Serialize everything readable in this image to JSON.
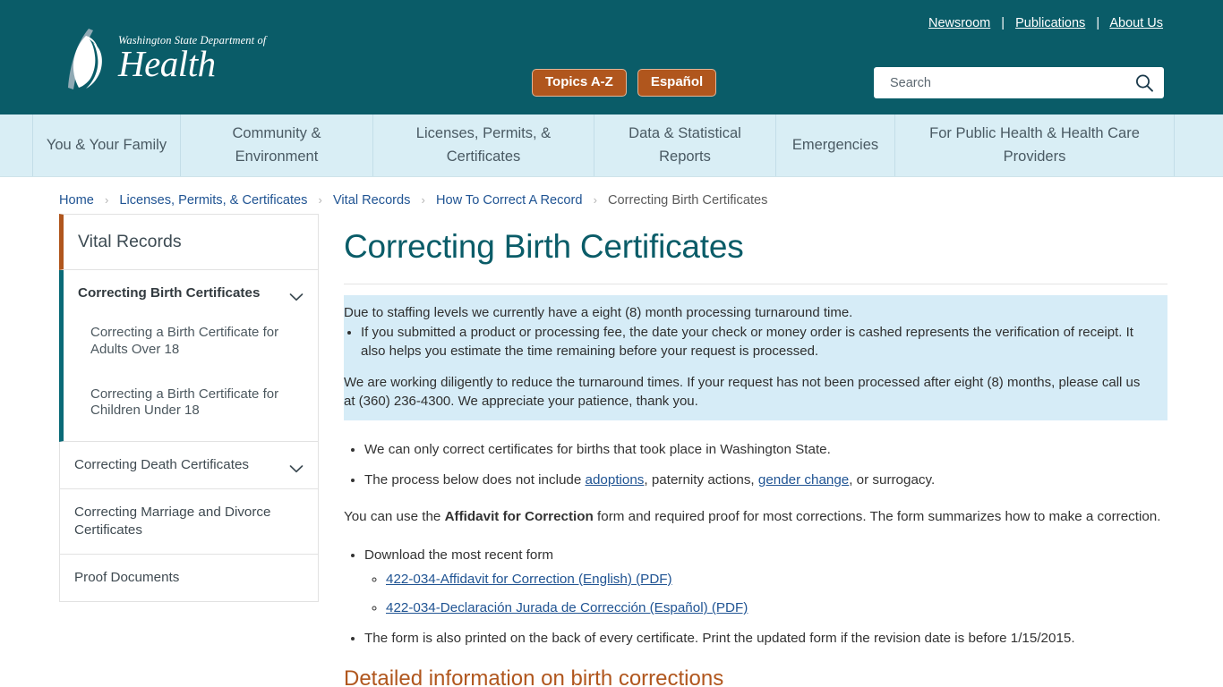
{
  "header": {
    "logo": {
      "icon": "doh-flame-logo",
      "line1": "Washington State Department of",
      "line2": "Health"
    },
    "util_links": [
      {
        "label": "Newsroom"
      },
      {
        "label": "Publications"
      },
      {
        "label": "About Us"
      }
    ],
    "util_separator": "|",
    "buttons": [
      {
        "label": "Topics A-Z"
      },
      {
        "label": "Español"
      }
    ],
    "search": {
      "placeholder": "Search",
      "value": "",
      "icon": "search-icon"
    },
    "colors": {
      "header_bg": "#0a5c68",
      "pill_bg": "#b0561d",
      "nav_bg": "#d9eef5",
      "accent_orange": "#b0561d",
      "accent_teal": "#0a6a77",
      "link_blue": "#205493",
      "alert_bg": "#d6ecf7"
    }
  },
  "nav": {
    "items": [
      {
        "label": "You & Your Family"
      },
      {
        "label": "Community & Environment"
      },
      {
        "label": "Licenses, Permits, & Certificates"
      },
      {
        "label": "Data & Statistical Reports"
      },
      {
        "label": "Emergencies"
      },
      {
        "label": "For Public Health & Health Care Providers"
      }
    ]
  },
  "breadcrumb": {
    "separator": "›",
    "items": [
      {
        "label": "Home",
        "current": false
      },
      {
        "label": "Licenses, Permits, & Certificates",
        "current": false
      },
      {
        "label": "Vital Records",
        "current": false
      },
      {
        "label": "How To Correct A Record",
        "current": false
      },
      {
        "label": "Correcting Birth Certificates",
        "current": true
      }
    ]
  },
  "sidebar": {
    "heading": "Vital Records",
    "active_group": {
      "title": "Correcting Birth Certificates",
      "chevron": "chevron-down-icon",
      "children": [
        {
          "label": "Correcting a Birth Certificate for Adults Over 18"
        },
        {
          "label": "Correcting a Birth Certificate for Children Under 18"
        }
      ]
    },
    "items": [
      {
        "label": "Correcting Death Certificates",
        "chevron": "chevron-down-icon",
        "expandable": true
      },
      {
        "label": "Correcting Marriage and Divorce Certificates",
        "expandable": false
      },
      {
        "label": "Proof Documents",
        "expandable": false
      }
    ]
  },
  "main": {
    "title": "Correcting Birth Certificates",
    "alert": {
      "intro": "Due to staffing levels we currently have a eight (8) month processing turnaround time.",
      "bullets": [
        "If you submitted a product or processing fee, the date your check or money order is cashed represents the verification of receipt. It also helps you estimate the time remaining before your request is processed."
      ],
      "closing": "We are working diligently to reduce the turnaround times. If your request has not been processed after eight (8) months, please call us at (360) 236-4300. We appreciate your patience, thank you."
    },
    "bullets": [
      {
        "text": "We can only correct certificates for births that took place in Washington State."
      }
    ],
    "process_bullet": {
      "pre": "The process below does not include ",
      "link1": "adoptions",
      "mid": ", paternity actions, ",
      "link2": "gender change",
      "post": ", or surrogacy."
    },
    "affidavit_para": {
      "pre": "You can use the ",
      "bold": "Affidavit for Correction",
      "post": " form and required proof for most corrections. The form summarizes how to make a correction."
    },
    "download": {
      "label": "Download the most recent form",
      "links": [
        {
          "label": "422-034-Affidavit for Correction (English) (PDF)"
        },
        {
          "label": "422-034-Declaración Jurada de Corrección (Español) (PDF)"
        }
      ]
    },
    "printed_note": "The form is also printed on the back of every certificate. Print the updated form if the revision date is before 1/15/2015.",
    "section_title": "Detailed information on birth corrections"
  }
}
